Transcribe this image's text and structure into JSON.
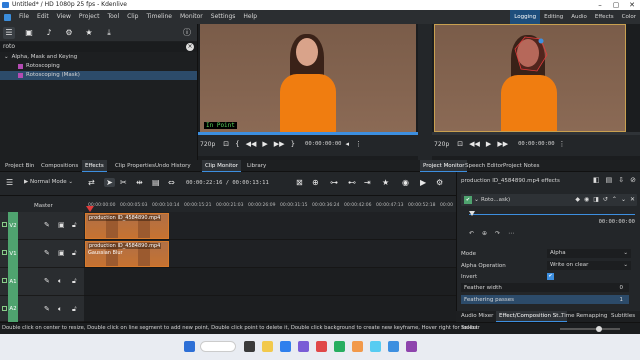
{
  "window": {
    "title": "Untitled* / HD 1080p 25 fps - Kdenlive",
    "controls": [
      "–",
      "▢",
      "✕"
    ]
  },
  "menu": {
    "items": [
      "File",
      "Edit",
      "View",
      "Project",
      "Tool",
      "Clip",
      "Timeline",
      "Monitor",
      "Settings",
      "Help"
    ],
    "layouts": [
      "Logging",
      "Editing",
      "Audio",
      "Effects",
      "Color"
    ],
    "active_layout": "Logging"
  },
  "effects_panel": {
    "search_value": "roto",
    "tree": [
      {
        "label": "Alpha, Mask and Keying",
        "kind": "category"
      },
      {
        "label": "Rotoscoping",
        "kind": "effect"
      },
      {
        "label": "Rotoscoping (Mask)",
        "kind": "effect",
        "selected": true
      }
    ]
  },
  "clip_monitor": {
    "overlay": "In Point",
    "resolution": "720p",
    "timecode": "00:00:00:00",
    "progress": 1.0
  },
  "project_monitor": {
    "resolution": "720p",
    "timecode": "00:00:00:00",
    "progress": 0.0
  },
  "tabs_left": [
    "Project Bin",
    "Compositions",
    "Effects",
    "Clip Properties",
    "Undo History",
    "Clip Monitor",
    "Library"
  ],
  "tabs_right": [
    "Project Monitor",
    "Speech Editor",
    "Project Notes"
  ],
  "active_tabs": [
    "Effects",
    "Clip Monitor",
    "Project Monitor"
  ],
  "timeline": {
    "mode": "Normal Mode",
    "timecode_pos": "00:00:22:16",
    "timecode_len": "00:00:13:11",
    "master_label": "Master",
    "ruler": [
      "00:00:00:00",
      "00:00:05:03",
      "00:00:10:14",
      "00:00:15:21",
      "00:00:21:03",
      "00:00:26:09",
      "00:00:31:15",
      "00:00:36:24",
      "00:00:42:06",
      "00:00:47:13",
      "00:00:52:18",
      "00:00"
    ],
    "tracks": [
      {
        "label": "V2",
        "type": "video"
      },
      {
        "label": "V1",
        "type": "video"
      },
      {
        "label": "A1",
        "type": "audio"
      },
      {
        "label": "A2",
        "type": "audio"
      }
    ],
    "clips": [
      {
        "track": 0,
        "name": "production ID_4584890.mp4",
        "sub": ""
      },
      {
        "track": 1,
        "name": "production ID_4584890.mp4",
        "sub": "Gaussian Blur"
      }
    ]
  },
  "effect_stack": {
    "title": "production ID_4584890.mp4 effects",
    "effect_name": "Roto...ask)",
    "timecode": "00:00:00:00",
    "params": [
      {
        "label": "Mode",
        "value": "Alpha",
        "kind": "select"
      },
      {
        "label": "Alpha Operation",
        "value": "Write on clear",
        "kind": "select"
      },
      {
        "label": "Invert",
        "value": "✔",
        "kind": "check"
      },
      {
        "label": "Feather width",
        "value": "0",
        "kind": "slider",
        "fill": 0.0
      },
      {
        "label": "Feathering passes",
        "value": "1",
        "kind": "slider",
        "fill": 1.0
      }
    ],
    "bottom_tabs": [
      "Audio Mixer",
      "Effect/Composition St...",
      "Time Remapping",
      "Subtitles"
    ],
    "active_bottom_tab": "Effect/Composition St..."
  },
  "status": {
    "message": "Double click on center to resize, Double click on line segment to add new point, Double click point to delete it, Double click background to create new keyframe, Hover right for toolbar",
    "tool": "Select"
  },
  "taskbar": {
    "time": "",
    "date": ""
  },
  "colors": {
    "accent": "#3d8fe0",
    "track_green": "#4fa36f",
    "clip": "#9b5a2f",
    "shirt": "#f07d10"
  }
}
